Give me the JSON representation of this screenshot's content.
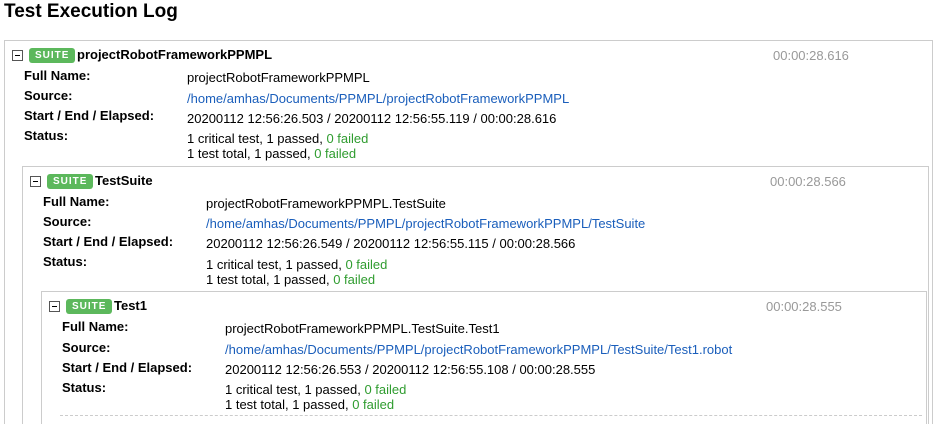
{
  "page_title": "Test Execution Log",
  "suites": [
    {
      "badge": "SUITE",
      "name": "projectRobotFrameworkPPMPL",
      "elapsed": "00:00:28.616",
      "labels": {
        "full_name": "Full Name:",
        "source": "Source:",
        "times": "Start / End / Elapsed:",
        "status": "Status:"
      },
      "full_name": "projectRobotFrameworkPPMPL",
      "source": "/home/amhas/Documents/PPMPL/projectRobotFrameworkPPMPL",
      "times": "20200112 12:56:26.503 / 20200112 12:56:55.119 / 00:00:28.616",
      "status_critical": "1 critical test, 1 passed, ",
      "status_critical_failed": "0 failed",
      "status_total": "1 test total, 1 passed, ",
      "status_total_failed": "0 failed"
    },
    {
      "badge": "SUITE",
      "name": "TestSuite",
      "elapsed": "00:00:28.566",
      "labels": {
        "full_name": "Full Name:",
        "source": "Source:",
        "times": "Start / End / Elapsed:",
        "status": "Status:"
      },
      "full_name": "projectRobotFrameworkPPMPL.TestSuite",
      "source": "/home/amhas/Documents/PPMPL/projectRobotFrameworkPPMPL/TestSuite",
      "times": "20200112 12:56:26.549 / 20200112 12:56:55.115 / 00:00:28.566",
      "status_critical": "1 critical test, 1 passed, ",
      "status_critical_failed": "0 failed",
      "status_total": "1 test total, 1 passed, ",
      "status_total_failed": "0 failed"
    },
    {
      "badge": "SUITE",
      "name": "Test1",
      "elapsed": "00:00:28.555",
      "labels": {
        "full_name": "Full Name:",
        "source": "Source:",
        "times": "Start / End / Elapsed:",
        "status": "Status:"
      },
      "full_name": "projectRobotFrameworkPPMPL.TestSuite.Test1",
      "source": "/home/amhas/Documents/PPMPL/projectRobotFrameworkPPMPL/TestSuite/Test1.robot",
      "times": "20200112 12:56:26.553 / 20200112 12:56:55.108 / 00:00:28.555",
      "status_critical": "1 critical test, 1 passed, ",
      "status_critical_failed": "0 failed",
      "status_total": "1 test total, 1 passed, ",
      "status_total_failed": "0 failed"
    }
  ],
  "colors": {
    "pass_badge": "#5cb85c",
    "link": "#1a5ebb",
    "failed_text": "#2f9c2f",
    "elapsed": "#999999"
  }
}
